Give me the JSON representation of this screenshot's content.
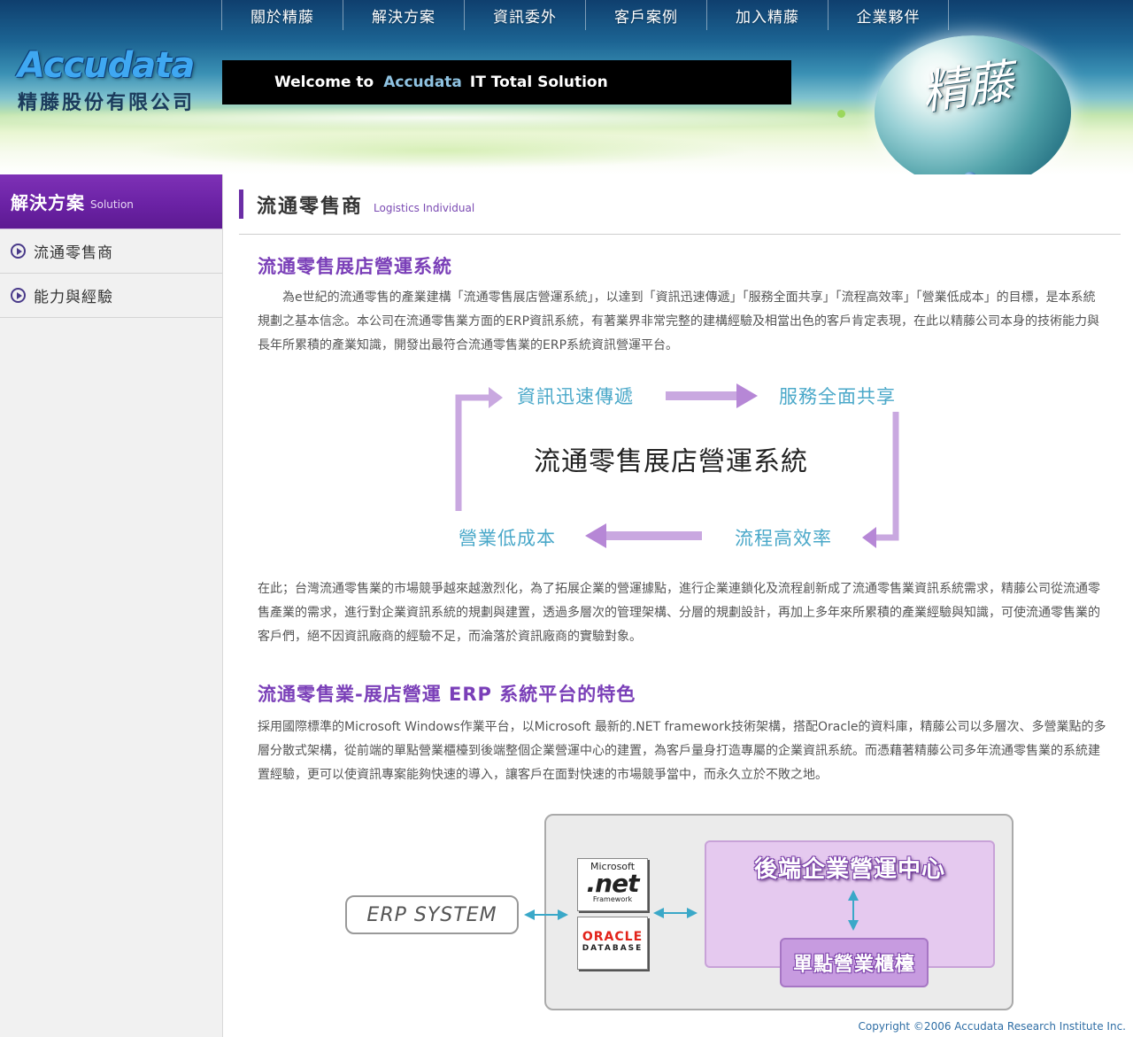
{
  "nav": {
    "items": [
      "關於精藤",
      "解決方案",
      "資訊委外",
      "客戶案例",
      "加入精藤",
      "企業夥伴"
    ]
  },
  "logo": {
    "en": "Accudata",
    "zh": "精藤股份有限公司"
  },
  "welcome": {
    "prefix": "Welcome to",
    "brand": "Accudata",
    "suffix": "IT Total Solution"
  },
  "globe": {
    "text": "精藤"
  },
  "sidebar": {
    "title_zh": "解決方案",
    "title_en": "Solution",
    "items": [
      {
        "label": "流通零售商"
      },
      {
        "label": "能力與經驗"
      }
    ]
  },
  "page": {
    "title_zh": "流通零售商",
    "title_en": "Logistics Individual"
  },
  "section1": {
    "title": "流通零售展店營運系統",
    "para1": "為e世紀的流通零售的產業建構「流通零售展店營運系統」，以達到「資訊迅速傳遞」「服務全面共享」「流程高效率」「營業低成本」的目標，是本系統規劃之基本信念。本公司在流通零售業方面的ERP資訊系統，有著業界非常完整的建構經驗及相當出色的客戶肯定表現，在此以精藤公司本身的技術能力與長年所累積的產業知識，開發出最符合流通零售業的ERP系統資訊營運平台。",
    "cycle": {
      "center": "流通零售展店營運系統",
      "top_left": "資訊迅速傳遞",
      "top_right": "服務全面共享",
      "bottom_right": "流程高效率",
      "bottom_left": "營業低成本"
    },
    "para2": "在此；台灣流通零售業的市場競爭越來越激烈化，為了拓展企業的營運據點，進行企業連鎖化及流程創新成了流通零售業資訊系統需求，精藤公司從流通零售產業的需求，進行對企業資訊系統的規劃與建置，透過多層次的管理架構、分層的規劃設計，再加上多年來所累積的產業經驗與知識，可使流通零售業的客戶們，絕不因資訊廠商的經驗不足，而淪落於資訊廠商的實驗對象。"
  },
  "section2": {
    "title": "流通零售業-展店營運 ERP 系統平台的特色",
    "para": "採用國際標準的Microsoft Windows作業平台，以Microsoft 最新的.NET framework技術架構，搭配Oracle的資料庫，精藤公司以多層次、多營業點的多層分散式架構，從前端的單點營業櫃檯到後端整個企業營運中心的建置，為客戶量身打造專屬的企業資訊系統。而憑藉著精藤公司多年流通零售業的系統建置經驗，更可以使資訊專案能夠快速的導入，讓客戶在面對快速的市場競爭當中，而永久立於不敗之地。",
    "diagram": {
      "erp_system": "ERP SYSTEM",
      "net_ms": "Microsoft",
      "net_name": ".net",
      "net_fw": "Framework",
      "oracle": "ORACLE",
      "oracle_db": "DATABASE",
      "backend": "後端企業營運中心",
      "single_point": "單點營業櫃檯"
    }
  },
  "footer": {
    "copyright": "Copyright ©2006 Accudata Research Institute Inc."
  },
  "colors": {
    "purple_accent": "#7a3fb8",
    "sidebar_purple": "#6b22a5",
    "cycle_text": "#4aa8c9",
    "cycle_arrow": "#c9a8e0",
    "diagram_arrow": "#3aa8c8",
    "copyright": "#2f6ea5"
  }
}
